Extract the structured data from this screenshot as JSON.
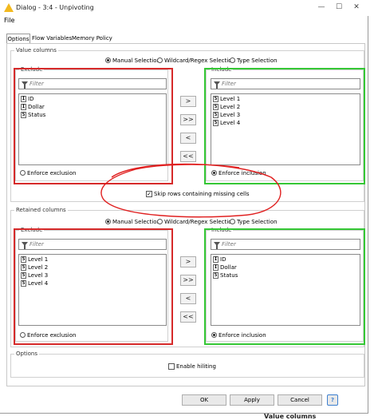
{
  "window": {
    "title": "Dialog - 3:4 - Unpivoting",
    "minimize_glyph": "—",
    "maximize_glyph": "☐",
    "close_glyph": "✕"
  },
  "menu": {
    "file": "File"
  },
  "tabs": [
    {
      "label": "Options",
      "active": true
    },
    {
      "label": "Flow Variables",
      "active": false
    },
    {
      "label": "Memory Policy",
      "active": false
    }
  ],
  "value_columns": {
    "title": "Value columns",
    "modes": [
      "Manual Selection",
      "Wildcard/Regex Selection",
      "Type Selection"
    ],
    "selected_mode": 0,
    "exclude": {
      "title": "Exclude",
      "filter_placeholder": "Filter",
      "items": [
        {
          "type": "I",
          "name": "ID"
        },
        {
          "type": "I",
          "name": "Dollar"
        },
        {
          "type": "S",
          "name": "Status"
        }
      ],
      "enforce_label": "Enforce exclusion",
      "enforce_selected": false
    },
    "include": {
      "title": "Include",
      "filter_placeholder": "Filter",
      "items": [
        {
          "type": "S",
          "name": "Level 1"
        },
        {
          "type": "S",
          "name": "Level 2"
        },
        {
          "type": "S",
          "name": "Level 3"
        },
        {
          "type": "S",
          "name": "Level 4"
        }
      ],
      "enforce_label": "Enforce inclusion",
      "enforce_selected": true
    },
    "arrows": [
      ">",
      ">>",
      "<",
      "<<"
    ],
    "skip_missing": {
      "label": "Skip rows containing missing cells",
      "checked": true,
      "glyph": "✓"
    }
  },
  "retained_columns": {
    "title": "Retained columns",
    "modes": [
      "Manual Selection",
      "Wildcard/Regex Selection",
      "Type Selection"
    ],
    "selected_mode": 0,
    "exclude": {
      "title": "Exclude",
      "filter_placeholder": "Filter",
      "items": [
        {
          "type": "S",
          "name": "Level 1"
        },
        {
          "type": "S",
          "name": "Level 2"
        },
        {
          "type": "S",
          "name": "Level 3"
        },
        {
          "type": "S",
          "name": "Level 4"
        }
      ],
      "enforce_label": "Enforce exclusion",
      "enforce_selected": false
    },
    "include": {
      "title": "Include",
      "filter_placeholder": "Filter",
      "items": [
        {
          "type": "I",
          "name": "ID"
        },
        {
          "type": "I",
          "name": "Dollar"
        },
        {
          "type": "S",
          "name": "Status"
        }
      ],
      "enforce_label": "Enforce inclusion",
      "enforce_selected": true
    },
    "arrows": [
      ">",
      ">>",
      "<",
      "<<"
    ]
  },
  "options": {
    "title": "Options",
    "hiliting": {
      "label": "Enable hiliting",
      "checked": false
    }
  },
  "buttons": {
    "ok": "OK",
    "apply": "Apply",
    "cancel": "Cancel",
    "help": "?"
  },
  "footer_text": "Value columns",
  "colors": {
    "exclude_border": "#d62a2a",
    "include_border": "#35c735",
    "annotation": "#e02020",
    "help_button": "#3c7fd0"
  }
}
